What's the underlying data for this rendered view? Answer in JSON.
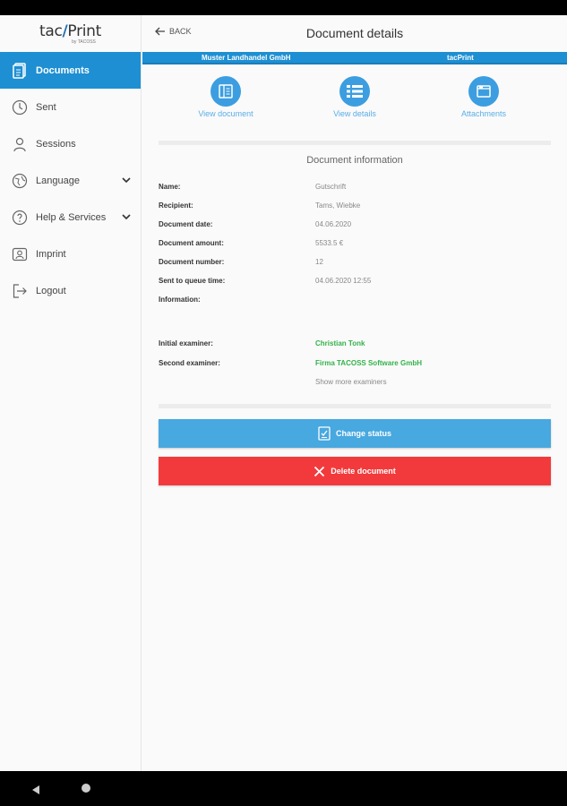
{
  "app": {
    "logo_prefix": "tac",
    "logo_suffix": "Print",
    "logo_sub": "by TACOSS"
  },
  "sidebar": {
    "items": [
      {
        "label": "Documents",
        "icon": "documents-icon",
        "active": true
      },
      {
        "label": "Sent",
        "icon": "clock-icon"
      },
      {
        "label": "Sessions",
        "icon": "user-icon"
      },
      {
        "label": "Language",
        "icon": "language-icon",
        "expandable": true
      },
      {
        "label": "Help & Services",
        "icon": "help-icon",
        "expandable": true
      },
      {
        "label": "Imprint",
        "icon": "imprint-icon"
      },
      {
        "label": "Logout",
        "icon": "logout-icon"
      }
    ]
  },
  "header": {
    "back_label": "BACK",
    "title": "Document details"
  },
  "banner": {
    "company": "Muster Landhandel GmbH",
    "product": "tacPrint"
  },
  "actions": [
    {
      "label": "View document",
      "icon": "view-document-icon"
    },
    {
      "label": "View details",
      "icon": "list-icon"
    },
    {
      "label": "Attachments",
      "icon": "attachment-icon"
    }
  ],
  "info": {
    "title": "Document information",
    "fields": [
      {
        "label": "Name:",
        "value": "Gutschrift"
      },
      {
        "label": "Recipient:",
        "value": "Tams, Wiebke"
      },
      {
        "label": "Document date:",
        "value": "04.06.2020"
      },
      {
        "label": "Document amount:",
        "value": "5533.5 €"
      },
      {
        "label": "Document number:",
        "value": "12"
      },
      {
        "label": "Sent to queue time:",
        "value": "04.06.2020 12:55"
      },
      {
        "label": "Information:",
        "value": ""
      }
    ],
    "examiners": [
      {
        "label": "Initial examiner:",
        "value": "Christian Tonk"
      },
      {
        "label": "Second examiner:",
        "value": "Firma TACOSS Software GmbH"
      }
    ],
    "show_more": "Show more examiners"
  },
  "buttons": {
    "change_status": "Change status",
    "delete": "Delete document"
  },
  "colors": {
    "primary": "#1e8fd2",
    "action_button": "#48a8e0",
    "danger": "#f23a3c",
    "examiner_green": "#33b24a"
  }
}
